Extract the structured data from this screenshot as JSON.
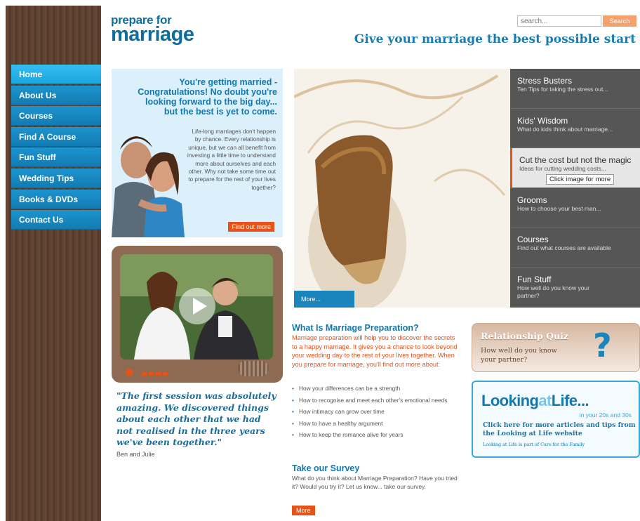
{
  "header": {
    "logo_line1": "prepare for",
    "logo_line2": "marriage",
    "tagline": "Give your marriage the best possible start",
    "search_placeholder": "search...",
    "search_button": "Search"
  },
  "nav": {
    "items": [
      {
        "label": "Home",
        "active": true
      },
      {
        "label": "About Us"
      },
      {
        "label": "Courses"
      },
      {
        "label": "Find A Course"
      },
      {
        "label": "Fun Stuff"
      },
      {
        "label": "Wedding Tips"
      },
      {
        "label": "Books & DVDs"
      },
      {
        "label": "Contact Us"
      }
    ]
  },
  "intro": {
    "title": "You're getting married - Congratulations! No doubt you're looking forward to the big day... but the best is yet to come.",
    "body": "Life-long marriages don't happen by chance. Every relationship is unique, but we can all benefit from investing a little time to understand more about ourselves and each other. Why not take some time out to prepare for the rest of your lives together?",
    "button": "Find out more"
  },
  "quote": {
    "text": "\"The first session was absolutely amazing. We discovered things about each other that we had not realised in the three years we've been together.\"",
    "author": "Ben and Julie"
  },
  "hero": {
    "more_label": "More...",
    "tooltip": "Click image for more"
  },
  "panel": {
    "items": [
      {
        "title": "Stress Busters",
        "sub": "Ten Tips for taking the stress out..."
      },
      {
        "title": "Kids' Wisdom",
        "sub": "What do kids think about marriage..."
      },
      {
        "title": "Cut the cost but not the magic",
        "sub": "Ideas for cutting wedding costs...",
        "active": true
      },
      {
        "title": "Grooms",
        "sub": "How to choose your best man..."
      },
      {
        "title": "Courses",
        "sub": "Find out what courses are available"
      },
      {
        "title": "Fun Stuff",
        "sub": "How well do you know your partner?"
      }
    ]
  },
  "what": {
    "title": "What Is Marriage Preparation?",
    "body": "Marriage preparation will help you to discover the secrets to a happy marriage. It gives you a chance to look beyond your wedding day to the rest of your lives together. When you prepare for marriage, you'll find out more about:",
    "list": [
      "How your differences can be a strength",
      "How to recognise and meet each other's emotional needs",
      "How intimacy can grow over time",
      "How to have a healthy argument",
      "How to keep the romance alive for years"
    ]
  },
  "survey": {
    "title": "Take our Survey",
    "body": "What do you think about Marriage Preparation? Have you tried it? Would you try it? Let us know... take our survey.",
    "button": "More"
  },
  "quiz": {
    "title": "Relationship Quiz",
    "sub": "How well do you know your partner?",
    "icon": "question-icon"
  },
  "lal": {
    "logo_a": "Looking",
    "logo_b": "at",
    "logo_c": "Life...",
    "tag": "in your 20s and 30s",
    "body": "Click here for more articles and tips from the Looking at Life website",
    "note": "Looking at Life is part of Care for the Family"
  }
}
